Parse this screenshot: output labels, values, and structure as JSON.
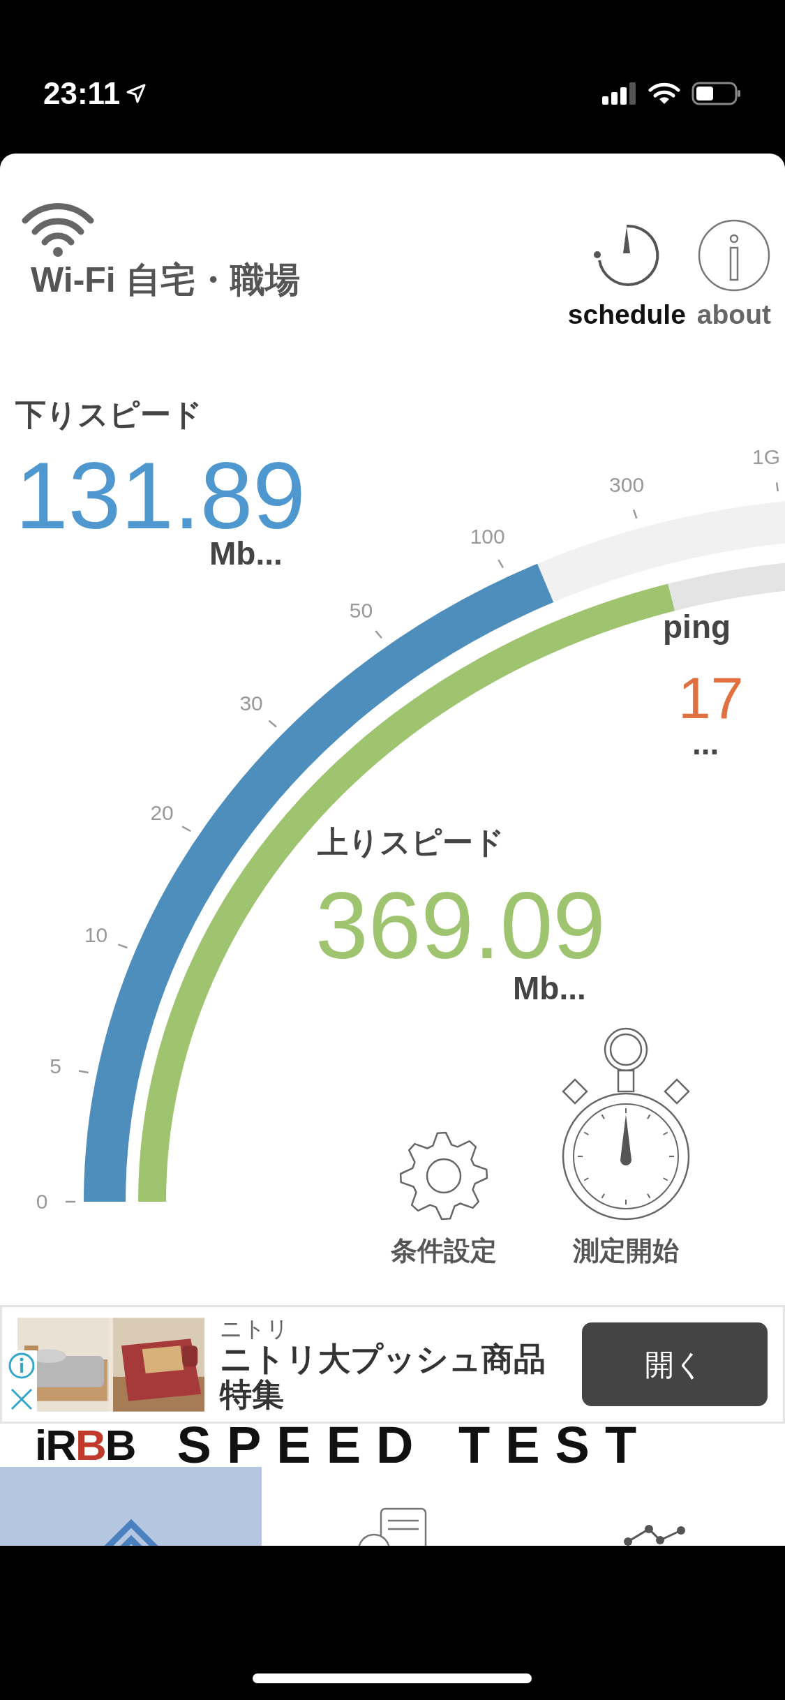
{
  "status_bar": {
    "time": "23:11"
  },
  "header": {
    "network_label": "Wi-Fi 自宅・職場",
    "actions": [
      {
        "kind": "schedule",
        "label": "schedule"
      },
      {
        "kind": "about",
        "label": "about"
      }
    ]
  },
  "download": {
    "label": "下りスピード",
    "value": "131.89",
    "unit": "Mb..."
  },
  "upload": {
    "label": "上りスピード",
    "value": "369.09",
    "unit": "Mb..."
  },
  "ping": {
    "label": "ping",
    "value": "17",
    "unit": "..."
  },
  "gauge": {
    "ticks": [
      "0",
      "5",
      "10",
      "20",
      "30",
      "50",
      "100",
      "300",
      "1G"
    ]
  },
  "controls": [
    {
      "kind": "settings",
      "label": "条件設定"
    },
    {
      "kind": "start",
      "label": "測定開始"
    }
  ],
  "ad": {
    "kind": "picture",
    "advertiser": "ニトリ",
    "headline": "ニトリ大プッシュ商品特集",
    "button": "開く"
  },
  "logo": {
    "mark": "iRBB",
    "title": "SPEED TEST"
  },
  "tabs": [
    {
      "kind": "home",
      "selected": true
    },
    {
      "kind": "document",
      "selected": false
    },
    {
      "kind": "chart",
      "selected": false
    }
  ]
}
